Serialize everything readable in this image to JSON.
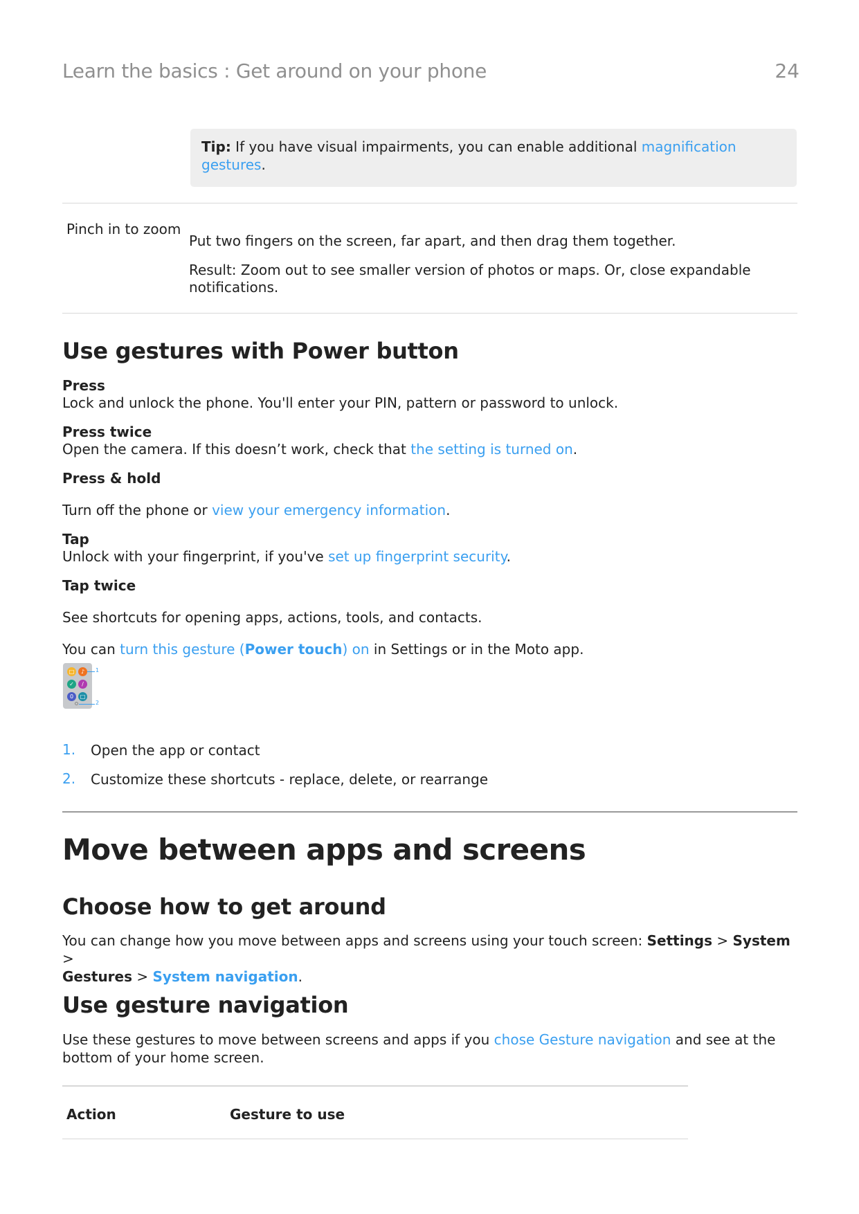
{
  "header": {
    "title": "Learn the basics : Get around on your phone",
    "page_number": "24"
  },
  "tip": {
    "label": "Tip:",
    "text": " If you have visual impairments, you can enable additional ",
    "link": "magnification gestures",
    "end": "."
  },
  "pinch": {
    "term": "Pinch in to zoom",
    "instruction": "Put two fingers on the screen, far apart, and then drag them together.",
    "result_line1": "Result: Zoom out to see smaller version of photos or maps. Or, close expandable",
    "result_line2": "notifications."
  },
  "power_section": {
    "heading": "Use gestures with Power button",
    "items": [
      {
        "term": "Press",
        "text": "Lock and unlock the phone. You'll enter your PIN, pattern or password to unlock."
      },
      {
        "term": "Press twice",
        "text": "Open the camera. If this doesn’t work, check that ",
        "link": "the setting is turned on",
        "end": "."
      },
      {
        "term": "Press & hold",
        "text": "Turn off the phone or ",
        "link": "view your emergency information",
        "end": "."
      },
      {
        "term": "Tap",
        "text": "Unlock with your fingerprint, if you've ",
        "link": "set up fingerprint security",
        "end": "."
      },
      {
        "term": "Tap twice",
        "text": "See shortcuts for opening apps, actions, tools, and contacts."
      }
    ],
    "power_touch": {
      "prefix": "You can ",
      "link_start": "turn this gesture (",
      "link_bold": "Power touch",
      "link_end": ") on",
      "suffix": " in Settings or in the Moto app."
    },
    "shortcut_graphic": {
      "icons": [
        {
          "name": "calendar-icon",
          "color": "#f6b52e",
          "glyph": "□"
        },
        {
          "name": "music-icon",
          "color": "#ef7320",
          "glyph": "♪"
        },
        {
          "name": "cleaner-icon",
          "color": "#1ea585",
          "glyph": "✓"
        },
        {
          "name": "tool-icon",
          "color": "#b03ab0",
          "glyph": "/"
        },
        {
          "name": "timer-icon",
          "color": "#4a5bc6",
          "glyph": "0"
        },
        {
          "name": "contact-icon",
          "color": "#1e8fa8",
          "glyph": "□"
        }
      ],
      "callout_1": "1",
      "callout_2": "2"
    },
    "steps": [
      {
        "num": "1.",
        "text": "Open the app or contact"
      },
      {
        "num": "2.",
        "text": "Customize these shortcuts - replace, delete, or rearrange"
      }
    ]
  },
  "move_section": {
    "heading": "Move between apps and screens",
    "choose": {
      "heading": "Choose how to get around",
      "text_prefix": "You can change how you move between apps and screens using your touch screen: ",
      "settings": "Settings",
      "sep1": " > ",
      "system": "System",
      "sep2": " >",
      "gestures": "Gestures",
      "sep3": " > ",
      "system_navigation": "System navigation",
      "end": "."
    },
    "gesture_nav": {
      "heading": "Use gesture navigation",
      "text_prefix": "Use these gestures to move between screens and apps if you ",
      "link": "chose Gesture navigation",
      "text_suffix": " and see at the",
      "line2": "bottom of your home screen."
    },
    "table": {
      "headers": [
        "Action",
        "Gesture to use"
      ]
    }
  },
  "colors": {
    "link": "#3a9ff0",
    "header_gray": "#8f8f8f",
    "tip_bg": "#eeeeee",
    "text": "#222222"
  }
}
